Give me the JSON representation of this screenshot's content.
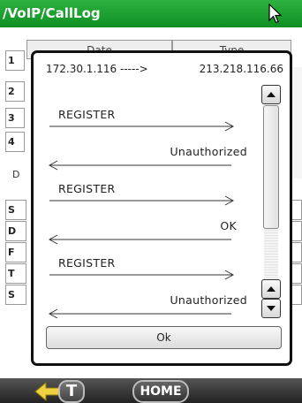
{
  "window": {
    "title": "/VoIP/CallLog"
  },
  "table": {
    "headers": [
      "Date",
      "Type"
    ],
    "row_numbers": [
      "1",
      "2",
      "3",
      "4"
    ],
    "section_letter": "D",
    "lower_rows": [
      "S",
      "D",
      "F",
      "T",
      "S"
    ]
  },
  "dialog": {
    "from_address": "172.30.1.116 ----->",
    "to_address": "213.218.116.66",
    "messages": [
      {
        "label": "REGISTER",
        "direction": "right"
      },
      {
        "label": "Unauthorized",
        "direction": "left"
      },
      {
        "label": "REGISTER",
        "direction": "right"
      },
      {
        "label": "OK",
        "direction": "left"
      },
      {
        "label": "REGISTER",
        "direction": "right"
      },
      {
        "label": "Unauthorized",
        "direction": "left"
      }
    ],
    "ok_label": "Ok"
  },
  "bottom_bar": {
    "t_label": "T",
    "home_label": "HOME"
  }
}
